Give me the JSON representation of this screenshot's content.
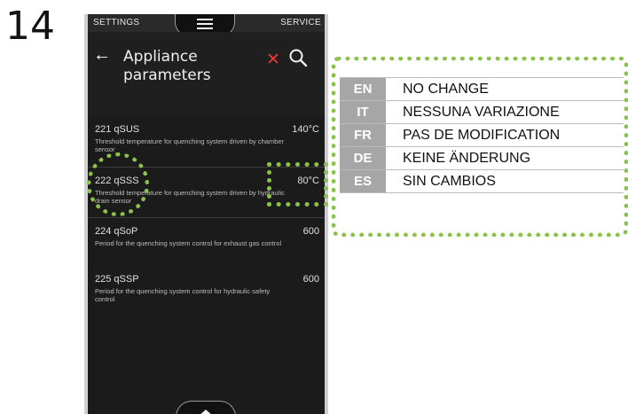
{
  "step_number": "14",
  "topbar": {
    "left": "SETTINGS",
    "right": "SERVICE",
    "menu_icon": "hamburger-menu-icon"
  },
  "header": {
    "title": "Appliance parameters",
    "back_icon": "back-arrow-icon",
    "close_icon": "close-icon",
    "search_icon": "search-icon"
  },
  "params": [
    {
      "code": "221 qSUS",
      "value": "140°C",
      "description": "Threshold temperature for quenching system driven by chamber sensor"
    },
    {
      "code": "222 qSSS",
      "value": "80°C",
      "description": "Threshold temperature for quenching system driven by hydraulic drain sensor"
    },
    {
      "code": "224 qSoP",
      "value": "600",
      "description": "Period for the quenching system control for exhaust gas control"
    },
    {
      "code": "225 qSSP",
      "value": "600",
      "description": "Period for the quenching system control for hydraulic safety control"
    }
  ],
  "bottom_tab_icon": "chevron-up-icon",
  "translations": [
    {
      "lang": "EN",
      "text": "NO CHANGE"
    },
    {
      "lang": "IT",
      "text": "NESSUNA VARIAZIONE"
    },
    {
      "lang": "FR",
      "text": "PAS DE MODIFICATION"
    },
    {
      "lang": "DE",
      "text": "KEINE ÄNDERUNG"
    },
    {
      "lang": "ES",
      "text": "SIN CAMBIOS"
    }
  ],
  "colors": {
    "highlight": "#8bc34a",
    "close": "#e53935",
    "phone_bg": "#1b1b1b",
    "lang_cell": "#a6a6a6"
  }
}
